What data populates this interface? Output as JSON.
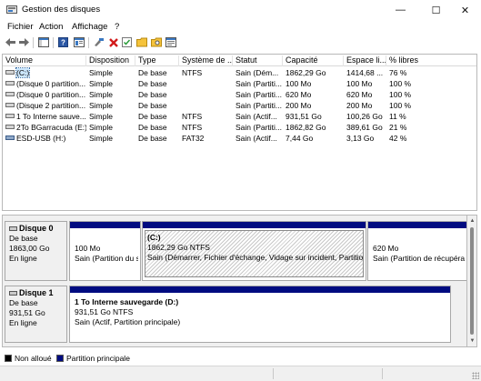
{
  "window": {
    "title": "Gestion des disques",
    "controls": {
      "minimize": "—",
      "maximize": "☐",
      "close": "✕"
    }
  },
  "menu": [
    "Fichier",
    "Action",
    "Affichage",
    "?"
  ],
  "toolbar": {
    "icons": [
      "back-icon",
      "forward-icon",
      "show-hide-console-tree-icon",
      "help-icon",
      "properties-icon",
      "connect-disk-icon",
      "delete-icon",
      "check-icon",
      "folder-open-icon",
      "folder-search-icon",
      "settings-panel-icon"
    ]
  },
  "volumes": {
    "columns": [
      "Volume",
      "Disposition",
      "Type",
      "Système de ...",
      "Statut",
      "Capacité",
      "Espace li...",
      "% libres"
    ],
    "rows": [
      {
        "volume": "(C:)",
        "disposition": "Simple",
        "type": "De base",
        "fs": "NTFS",
        "statut": "Sain (Dém...",
        "capacite": "1862,29 Go",
        "espace": "1414,68 ...",
        "libres": "76 %",
        "icon": "drive-icon"
      },
      {
        "volume": "(Disque 0 partition...",
        "disposition": "Simple",
        "type": "De base",
        "fs": "",
        "statut": "Sain (Partiti...",
        "capacite": "100 Mo",
        "espace": "100 Mo",
        "libres": "100 %",
        "icon": "drive-icon"
      },
      {
        "volume": "(Disque 0 partition...",
        "disposition": "Simple",
        "type": "De base",
        "fs": "",
        "statut": "Sain (Partiti...",
        "capacite": "620 Mo",
        "espace": "620 Mo",
        "libres": "100 %",
        "icon": "drive-icon"
      },
      {
        "volume": "(Disque 2 partition...",
        "disposition": "Simple",
        "type": "De base",
        "fs": "",
        "statut": "Sain (Partiti...",
        "capacite": "200 Mo",
        "espace": "200 Mo",
        "libres": "100 %",
        "icon": "drive-icon"
      },
      {
        "volume": "1 To Interne sauve...",
        "disposition": "Simple",
        "type": "De base",
        "fs": "NTFS",
        "statut": "Sain (Actif...",
        "capacite": "931,51 Go",
        "espace": "100,26 Go",
        "libres": "11 %",
        "icon": "drive-icon"
      },
      {
        "volume": "2To BGarracuda (E:)",
        "disposition": "Simple",
        "type": "De base",
        "fs": "NTFS",
        "statut": "Sain (Partiti...",
        "capacite": "1862,82 Go",
        "espace": "389,61 Go",
        "libres": "21 %",
        "icon": "drive-icon"
      },
      {
        "volume": "ESD-USB (H:)",
        "disposition": "Simple",
        "type": "De base",
        "fs": "FAT32",
        "statut": "Sain (Actif...",
        "capacite": "7,44 Go",
        "espace": "3,13 Go",
        "libres": "42 %",
        "icon": "usb-drive-icon"
      }
    ]
  },
  "disks": [
    {
      "name": "Disque 0",
      "type": "De base",
      "size": "1863,00 Go",
      "state": "En ligne",
      "partitions": [
        {
          "title": "",
          "size": "100 Mo",
          "status": "Sain (Partition du s"
        },
        {
          "title": "(C:)",
          "size": "1862,29 Go NTFS",
          "status": "Sain (Démarrer, Fichier d'échange, Vidage sur incident, Partition"
        },
        {
          "title": "",
          "size": "620 Mo",
          "status": "Sain (Partition de récupérat"
        }
      ]
    },
    {
      "name": "Disque 1",
      "type": "De base",
      "size": "931,51 Go",
      "state": "En ligne",
      "partitions": [
        {
          "title": "1 To Interne sauvegarde  (D:)",
          "size": "931,51 Go NTFS",
          "status": "Sain (Actif, Partition principale)"
        }
      ]
    }
  ],
  "legend": [
    {
      "label": "Non alloué",
      "color": "#000000"
    },
    {
      "label": "Partition principale",
      "color": "#000b80"
    }
  ],
  "colors": {
    "partition_bar": "#000b80",
    "selection": "#cde8ff"
  }
}
